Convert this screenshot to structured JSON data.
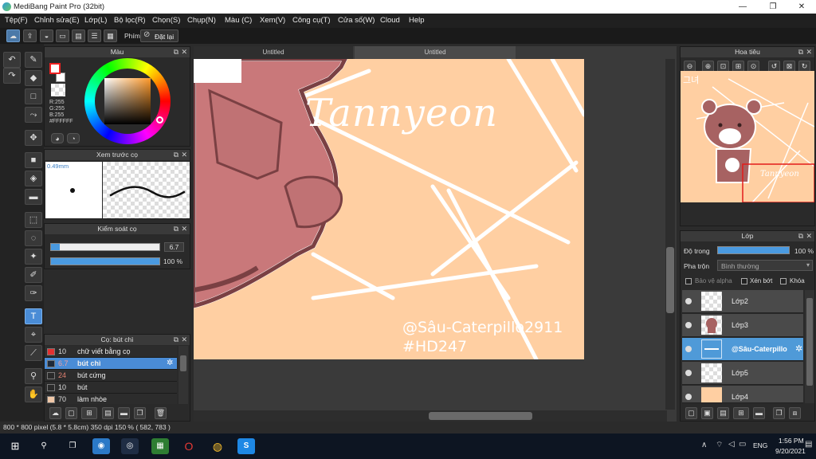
{
  "window": {
    "title": "MediBang Paint Pro (32bit)",
    "minimize": "—",
    "maximize": "❐",
    "close": "✕"
  },
  "menu": [
    "Tệp(F)",
    "Chỉnh sửa(E)",
    "Lớp(L)",
    "Bộ lọc(R)",
    "Chọn(S)",
    "Chụp(N)",
    "Màu (C)",
    "Xem(V)",
    "Công cụ(T)",
    "Cửa số(W)",
    "Cloud",
    "Help"
  ],
  "toolbar": {
    "keys_label": "Phím",
    "reset_label": "Đặt lại"
  },
  "panels": {
    "color": {
      "title": "Màu",
      "rgb": [
        "R:255",
        "G:255",
        "B:255",
        "#FFFFFF"
      ],
      "fg_color": "#ffffff",
      "bg_color": "#ffffff"
    },
    "brush_preview": {
      "title": "Xem trước cọ",
      "size_label": "0.49mm"
    },
    "brush_control": {
      "title": "Kiểm soát cọ",
      "size_value": "6.7",
      "size_fraction": 0.08,
      "opacity_value": "100 %",
      "opacity_fraction": 1.0
    },
    "brush_list": {
      "title": "Cọ: bút chì",
      "items": [
        {
          "size": "10",
          "name": "chữ viết bằng cọ",
          "color": "#e33131"
        },
        {
          "size": "6.7",
          "name": "bút chì",
          "color": "#1f2a3a",
          "selected": true
        },
        {
          "size": "24",
          "name": "bút cứng",
          "color": "#2a2a2a"
        },
        {
          "size": "10",
          "name": "bút",
          "color": "#2a2a2a"
        },
        {
          "size": "70",
          "name": "làm nhòe",
          "color": "#f0c8a8"
        }
      ]
    },
    "navigator": {
      "title": "Hoa tiêu"
    },
    "layers": {
      "title": "Lớp",
      "opacity_label": "Độ trong",
      "opacity_value": "100 %",
      "opacity_fraction": 1.0,
      "blend_label": "Pha trộn",
      "blend_value": "Bình thường",
      "protect_alpha": "Bảo vệ alpha",
      "clipping": "Xén bớt",
      "lock": "Khóa",
      "items": [
        {
          "name": "Lớp2",
          "selected": false
        },
        {
          "name": "Lớp3",
          "selected": false
        },
        {
          "name": "@Sâu-Caterpillo",
          "selected": true
        },
        {
          "name": "Lớp5",
          "selected": false
        },
        {
          "name": "Lớp4",
          "selected": false
        }
      ]
    }
  },
  "canvas": {
    "tabs": [
      "Untitled",
      "Untitled"
    ],
    "art_text": {
      "title": "Tannyeon",
      "credit": "@Sâu-Caterpillo2911",
      "tag": "#HD247"
    },
    "nav_text": {
      "korean": "그녀",
      "title": "Tannyeon"
    }
  },
  "status": {
    "text": "800 * 800 pixel   (5.8 * 5.8cm)   350 dpi   150 %   ( 582, 783 )"
  },
  "taskbar": {
    "lang": "ENG",
    "time": "1:56 PM",
    "date": "9/20/2021"
  }
}
